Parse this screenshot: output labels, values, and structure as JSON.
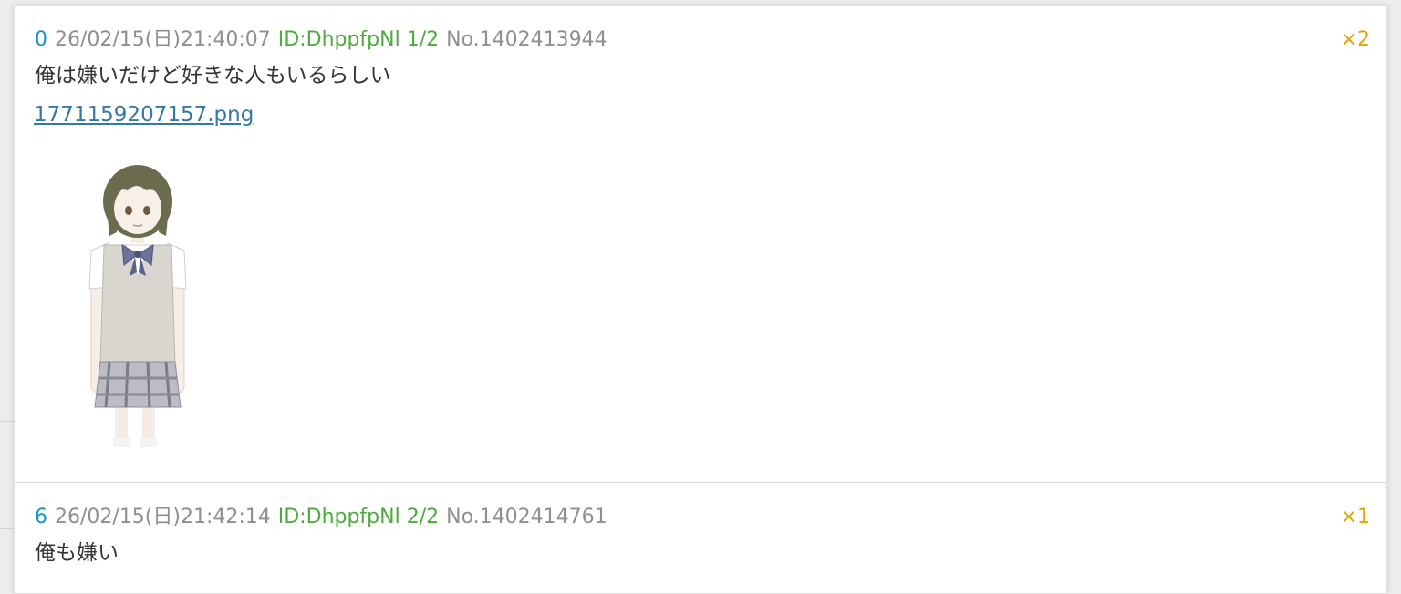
{
  "posts": [
    {
      "res_num": "0",
      "date": "26/02/15(日)21:40:07",
      "id": "ID:DhppfpNl 1/2",
      "post_no": "No.1402413944",
      "reply_count": "×2",
      "body": "俺は嫌いだけど好きな人もいるらしい",
      "file_name": "1771159207157.png"
    },
    {
      "res_num": "6",
      "date": "26/02/15(日)21:42:14",
      "id": "ID:DhppfpNl 2/2",
      "post_no": "No.1402414761",
      "reply_count": "×1",
      "body": "俺も嫌い"
    }
  ],
  "colors": {
    "res_num": "#1a93c4",
    "id": "#4caa3e",
    "meta": "#8f8f8f",
    "reply_count": "#e3a300",
    "link": "#3478a8"
  }
}
